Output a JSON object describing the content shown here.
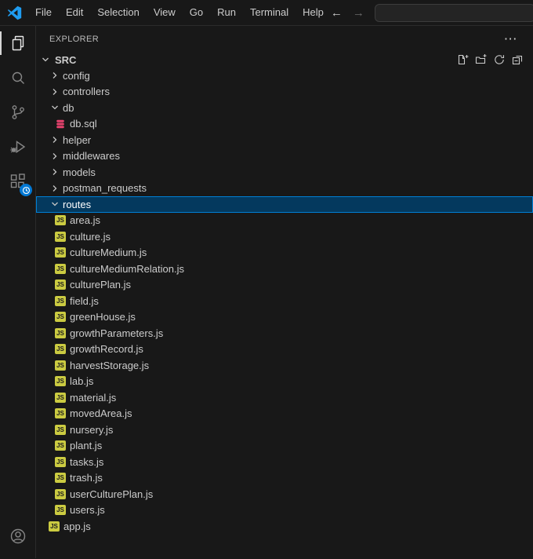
{
  "title_bar": {
    "menus": [
      "File",
      "Edit",
      "Selection",
      "View",
      "Go",
      "Run",
      "Terminal",
      "Help"
    ],
    "back_glyph": "←",
    "forward_glyph": "→",
    "search": {
      "value": "",
      "placeholder": ""
    }
  },
  "activity_bar": {
    "items": [
      {
        "id": "explorer",
        "icon": "files-icon",
        "active": true
      },
      {
        "id": "search",
        "icon": "search-icon",
        "active": false
      },
      {
        "id": "source-control",
        "icon": "source-control-icon",
        "active": false
      },
      {
        "id": "run-debug",
        "icon": "run-debug-icon",
        "active": false
      },
      {
        "id": "extensions",
        "icon": "extensions-icon",
        "active": false,
        "badge": "clock-badge-icon"
      }
    ],
    "bottom_items": [
      {
        "id": "account",
        "icon": "account-icon"
      }
    ]
  },
  "explorer": {
    "title": "EXPLORER",
    "more_actions_glyph": "⋯",
    "section": "SRC",
    "js_badge_text": "JS",
    "actions": [
      "new-file-icon",
      "new-folder-icon",
      "refresh-icon",
      "collapse-all-icon"
    ],
    "tree": [
      {
        "label": "config",
        "type": "folder",
        "state": "collapsed",
        "level": 1
      },
      {
        "label": "controllers",
        "type": "folder",
        "state": "collapsed",
        "level": 1
      },
      {
        "label": "db",
        "type": "folder",
        "state": "expanded",
        "level": 1
      },
      {
        "label": "db.sql",
        "type": "file",
        "icon": "sql",
        "level": 2
      },
      {
        "label": "helper",
        "type": "folder",
        "state": "collapsed",
        "level": 1
      },
      {
        "label": "middlewares",
        "type": "folder",
        "state": "collapsed",
        "level": 1
      },
      {
        "label": "models",
        "type": "folder",
        "state": "collapsed",
        "level": 1
      },
      {
        "label": "postman_requests",
        "type": "folder",
        "state": "collapsed",
        "level": 1
      },
      {
        "label": "routes",
        "type": "folder",
        "state": "expanded",
        "level": 1,
        "selected": true
      },
      {
        "label": "area.js",
        "type": "file",
        "icon": "js",
        "level": 2
      },
      {
        "label": "culture.js",
        "type": "file",
        "icon": "js",
        "level": 2
      },
      {
        "label": "cultureMedium.js",
        "type": "file",
        "icon": "js",
        "level": 2
      },
      {
        "label": "cultureMediumRelation.js",
        "type": "file",
        "icon": "js",
        "level": 2
      },
      {
        "label": "culturePlan.js",
        "type": "file",
        "icon": "js",
        "level": 2
      },
      {
        "label": "field.js",
        "type": "file",
        "icon": "js",
        "level": 2
      },
      {
        "label": "greenHouse.js",
        "type": "file",
        "icon": "js",
        "level": 2
      },
      {
        "label": "growthParameters.js",
        "type": "file",
        "icon": "js",
        "level": 2
      },
      {
        "label": "growthRecord.js",
        "type": "file",
        "icon": "js",
        "level": 2
      },
      {
        "label": "harvestStorage.js",
        "type": "file",
        "icon": "js",
        "level": 2
      },
      {
        "label": "lab.js",
        "type": "file",
        "icon": "js",
        "level": 2
      },
      {
        "label": "material.js",
        "type": "file",
        "icon": "js",
        "level": 2
      },
      {
        "label": "movedArea.js",
        "type": "file",
        "icon": "js",
        "level": 2
      },
      {
        "label": "nursery.js",
        "type": "file",
        "icon": "js",
        "level": 2
      },
      {
        "label": "plant.js",
        "type": "file",
        "icon": "js",
        "level": 2
      },
      {
        "label": "tasks.js",
        "type": "file",
        "icon": "js",
        "level": 2
      },
      {
        "label": "trash.js",
        "type": "file",
        "icon": "js",
        "level": 2
      },
      {
        "label": "userCulturePlan.js",
        "type": "file",
        "icon": "js",
        "level": 2
      },
      {
        "label": "users.js",
        "type": "file",
        "icon": "js",
        "level": 2
      },
      {
        "label": "app.js",
        "type": "file",
        "icon": "js",
        "level": 1
      }
    ]
  },
  "colors": {
    "accent": "#0078d4",
    "selection_background": "#04395e",
    "selection_border": "#007fd4",
    "js_icon_yellow": "#cbcb41",
    "sql_icon_pink": "#e5426d",
    "logo_blue": "#1f9cf0"
  }
}
